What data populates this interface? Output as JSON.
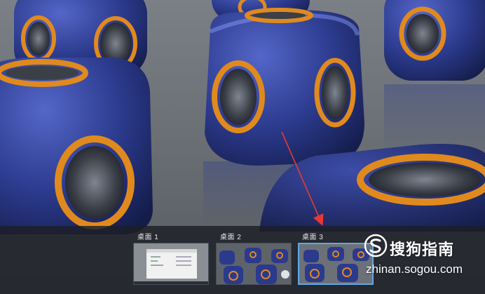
{
  "desktops": [
    {
      "label": "桌面 1",
      "active": false
    },
    {
      "label": "桌面 2",
      "active": false
    },
    {
      "label": "桌面 3",
      "active": true
    }
  ],
  "watermark": {
    "brand": "搜狗指南",
    "url": "zhinan.sogou.com",
    "logo_icon": "sogou-s-logo-icon"
  },
  "annotation": {
    "type": "red-arrow",
    "color": "#e53935"
  },
  "colors": {
    "cube_blue": "#2b3a8c",
    "ring_orange": "#e08a1e",
    "highlight": "#5fa8e8"
  }
}
